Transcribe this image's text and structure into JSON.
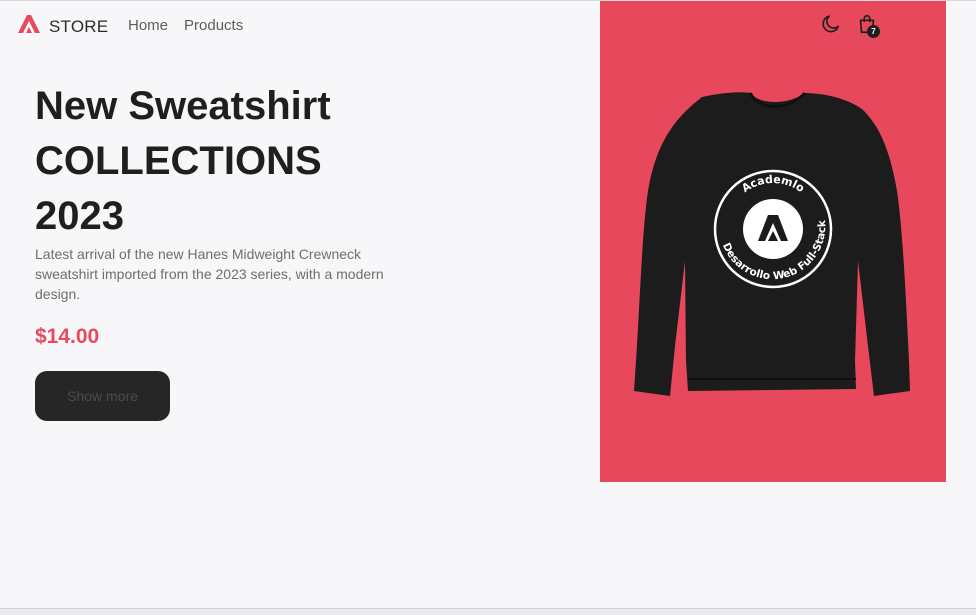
{
  "navbar": {
    "logo_icon": "academlo-logo-icon",
    "brand": "STORE",
    "links": [
      {
        "label": "Home"
      },
      {
        "label": "Products"
      }
    ],
    "icons": [
      "moon-icon",
      "shopping-bag-icon"
    ],
    "cart_count": "7"
  },
  "hero": {
    "title_lines": [
      "New Sweatshirt",
      "COLLECTIONS",
      "2023"
    ],
    "description": "Latest arrival of the new Hanes Midweight Crewneck sweatshirt imported from the 2023 series, with a modern design.",
    "price": "$14.00",
    "button_label": "Show more",
    "image": {
      "background_color": "#e8485b",
      "print_top_text": "Academlo",
      "print_bottom_text": "Desarrollo Web Full-Stack"
    }
  },
  "colors": {
    "accent": "#e64a5d",
    "dark": "#1f1f1f",
    "background": "#f7f7f9"
  }
}
